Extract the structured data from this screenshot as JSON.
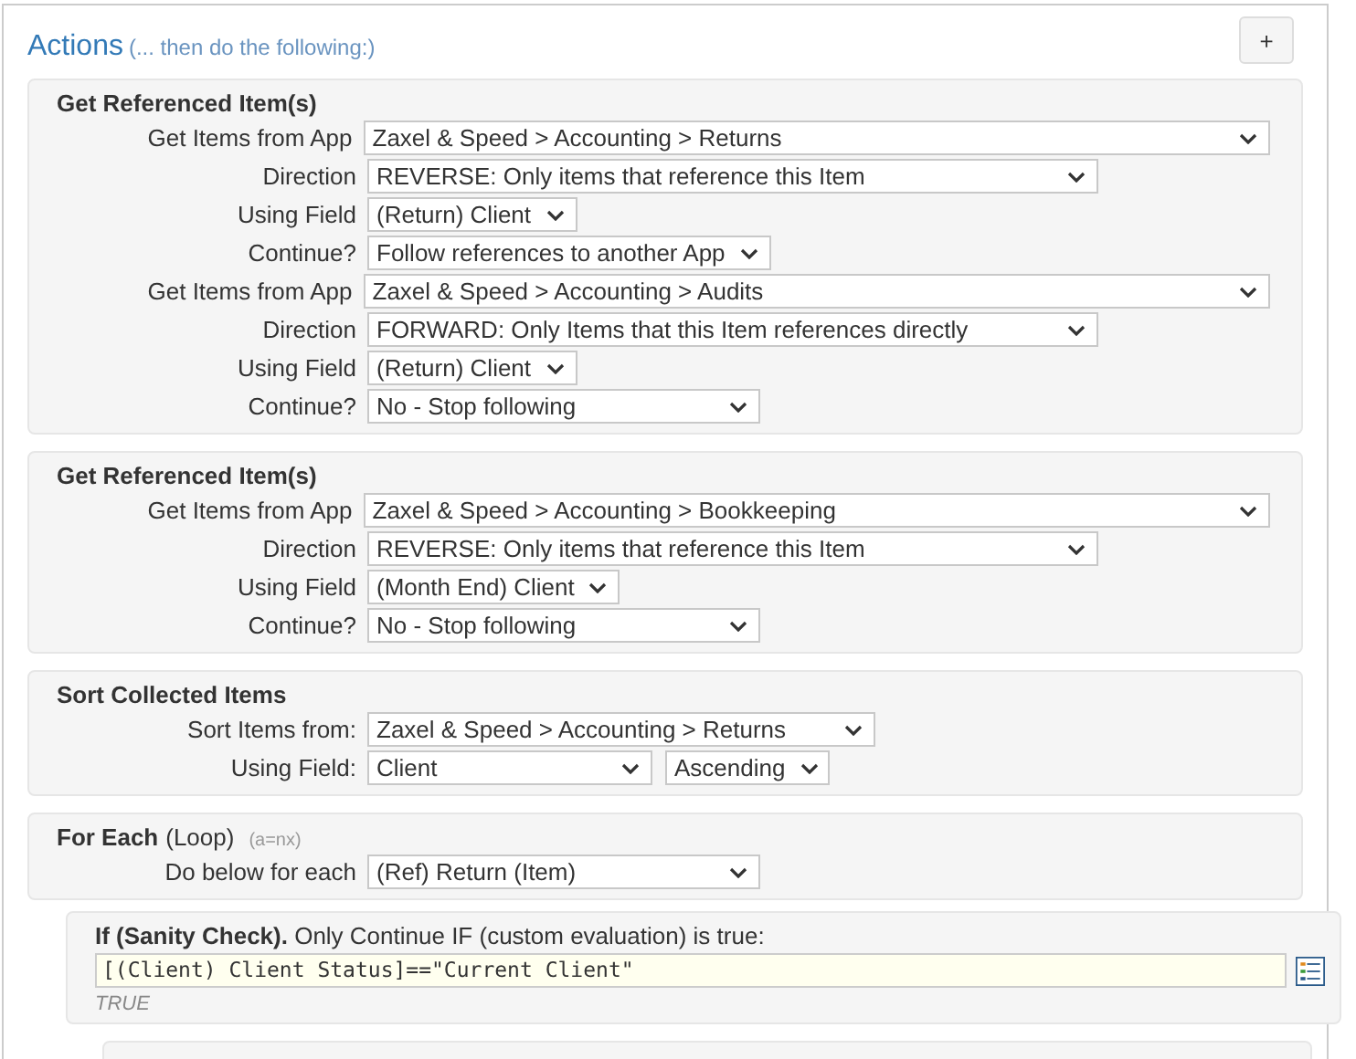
{
  "header": {
    "title": "Actions",
    "subtitle": "(... then do the following:)",
    "add_button": "+"
  },
  "sections": [
    {
      "kind": "rows",
      "title": "Get Referenced Item(s)",
      "rows": [
        {
          "kind": "app",
          "label": "Get Items from App",
          "value": "Zaxel & Speed > Accounting > Returns"
        },
        {
          "kind": "direction",
          "label": "Direction",
          "value": "REVERSE: Only items that reference this Item"
        },
        {
          "kind": "auto",
          "label": "Using Field",
          "value": "(Return) Client"
        },
        {
          "kind": "auto",
          "label": "Continue?",
          "value": "Follow references to another App"
        },
        {
          "kind": "app",
          "label": "Get Items from App",
          "value": "Zaxel & Speed > Accounting > Audits"
        },
        {
          "kind": "direction",
          "label": "Direction",
          "value": "FORWARD: Only Items that this Item references directly"
        },
        {
          "kind": "auto",
          "label": "Using Field",
          "value": "(Return) Client"
        },
        {
          "kind": "continue",
          "label": "Continue?",
          "value": "No - Stop following"
        }
      ]
    },
    {
      "kind": "rows",
      "title": "Get Referenced Item(s)",
      "rows": [
        {
          "kind": "app",
          "label": "Get Items from App",
          "value": "Zaxel & Speed > Accounting > Bookkeeping"
        },
        {
          "kind": "direction",
          "label": "Direction",
          "value": "REVERSE: Only items that reference this Item"
        },
        {
          "kind": "auto",
          "label": "Using Field",
          "value": "(Month End) Client"
        },
        {
          "kind": "continue",
          "label": "Continue?",
          "value": "No - Stop following"
        }
      ]
    },
    {
      "kind": "rows",
      "title": "Sort Collected Items",
      "rows": [
        {
          "kind": "sort",
          "label": "Sort Items from:",
          "value": "Zaxel & Speed > Accounting > Returns"
        },
        {
          "kind": "field",
          "label": "Using Field:",
          "value": "Client",
          "order": "Ascending"
        }
      ]
    },
    {
      "kind": "rows",
      "title": "For Each",
      "title_note": "(Loop)",
      "hint": "(a=nx)",
      "rows": [
        {
          "kind": "continue",
          "label": "Do below for each",
          "value": "(Ref) Return (Item)"
        }
      ]
    },
    {
      "kind": "condition",
      "title": "**If (Sanity Check).** Only Continue IF (custom evaluation) is true:",
      "expression": "[(Client) Client Status]==\"Current Client\"",
      "result": "TRUE"
    },
    {
      "kind": "stub"
    }
  ]
}
